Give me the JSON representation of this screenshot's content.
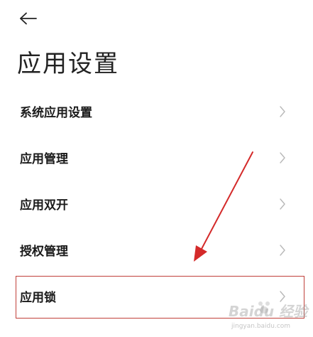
{
  "header": {
    "back_icon": "arrow-left-icon",
    "title": "应用设置"
  },
  "settings": {
    "items": [
      {
        "label": "系统应用设置",
        "icon": "chevron-right-icon"
      },
      {
        "label": "应用管理",
        "icon": "chevron-right-icon"
      },
      {
        "label": "应用双开",
        "icon": "chevron-right-icon"
      },
      {
        "label": "授权管理",
        "icon": "chevron-right-icon"
      },
      {
        "label": "应用锁",
        "icon": "chevron-right-icon"
      }
    ]
  },
  "annotation": {
    "highlight_color": "#c0403a",
    "arrow_color": "#d42a2a",
    "highlighted_item": "应用锁"
  },
  "watermark": {
    "text": "Baidu 经验",
    "subtext": "jingyan.baidu.com"
  }
}
